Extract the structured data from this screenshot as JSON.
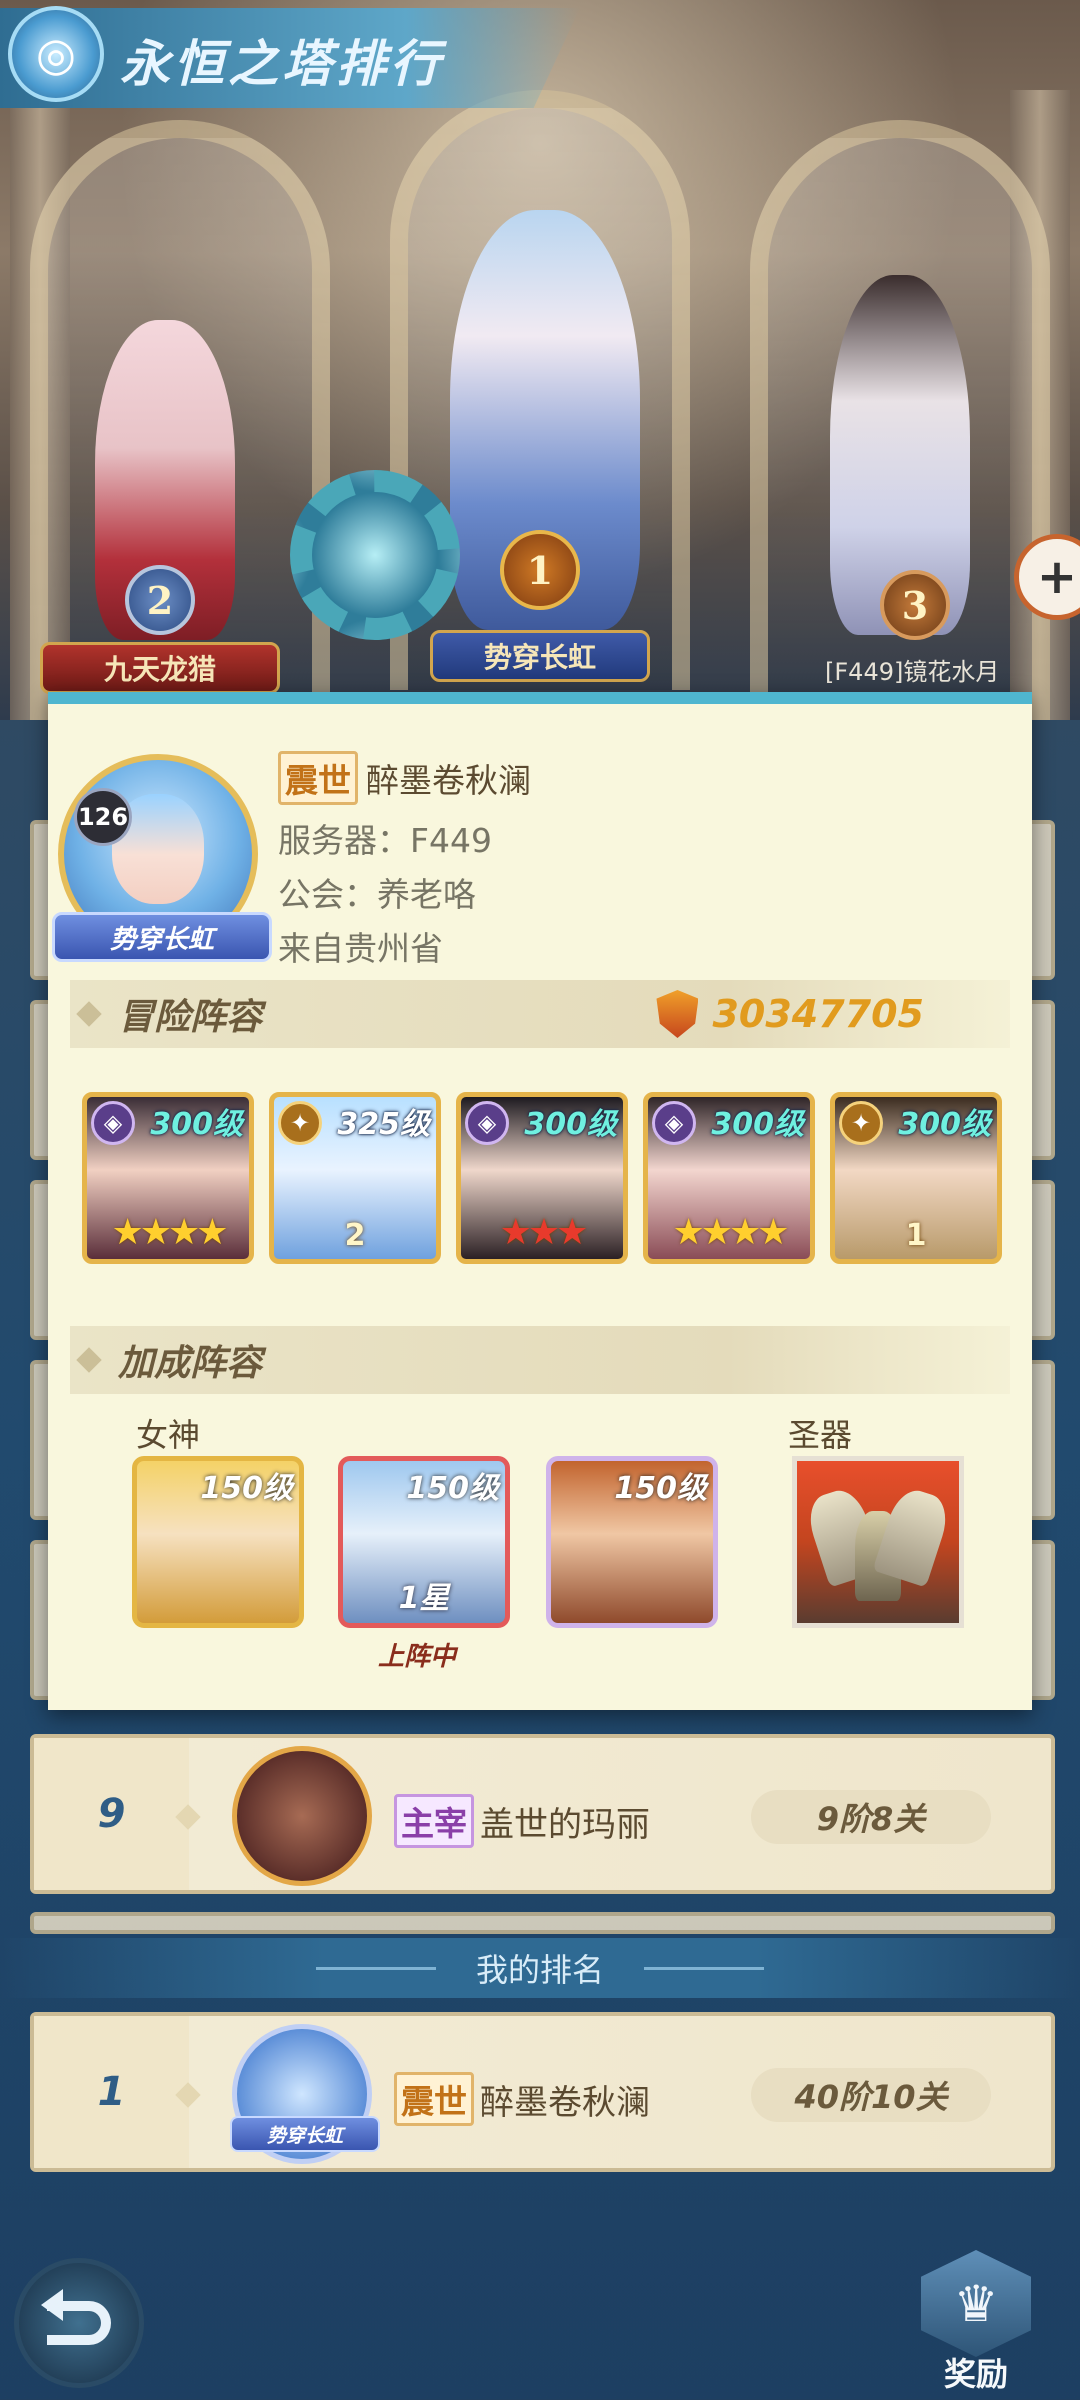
{
  "header": {
    "title": "永恒之塔排行",
    "emblem_icon": "tower-emblem-icon"
  },
  "podium": {
    "first": {
      "rank": "1",
      "plate": "势穿长虹"
    },
    "second": {
      "rank": "2",
      "plate": "九天龙猎"
    },
    "third": {
      "rank": "3",
      "name": "[F449]镜花水月"
    }
  },
  "profile": {
    "level": "126",
    "avatar_plate": "势穿长虹",
    "guild_tag": "震世",
    "name": "醉墨卷秋澜",
    "server": "服务器：F449",
    "guild": "公会：养老咯",
    "origin": "来自贵州省"
  },
  "adventure": {
    "title": "冒险阵容",
    "power": "30347705",
    "heroes": [
      {
        "level": "300级",
        "type": "dark",
        "stars": "★★★★",
        "star_color": "gold"
      },
      {
        "level": "325级",
        "type": "light",
        "stars": "2",
        "star_color": "wing"
      },
      {
        "level": "300级",
        "type": "dark",
        "stars": "★★★",
        "star_color": "red"
      },
      {
        "level": "300级",
        "type": "dark",
        "stars": "★★★★",
        "star_color": "gold"
      },
      {
        "level": "300级",
        "type": "light",
        "stars": "1",
        "star_color": "wing"
      }
    ]
  },
  "bonus": {
    "title": "加成阵容",
    "goddess_label": "女神",
    "artifact_label": "圣器",
    "goddesses": [
      {
        "level": "150级",
        "star": ""
      },
      {
        "level": "150级",
        "star": "1星",
        "status": "上阵中"
      },
      {
        "level": "150级",
        "star": ""
      }
    ]
  },
  "list": {
    "row9": {
      "rank": "9",
      "guild_tag": "主宰",
      "name": "盖世的玛丽",
      "floor": "9阶8关"
    }
  },
  "my_rank": {
    "title": "我的排名",
    "rank": "1",
    "plate": "势穿长虹",
    "guild_tag": "震世",
    "name": "醉墨卷秋澜",
    "floor": "40阶10关"
  },
  "footer": {
    "reward_label": "奖励"
  },
  "colors": {
    "accent": "#4fb6cf",
    "gold": "#e19b1e",
    "panel": "#f9f7dd"
  }
}
